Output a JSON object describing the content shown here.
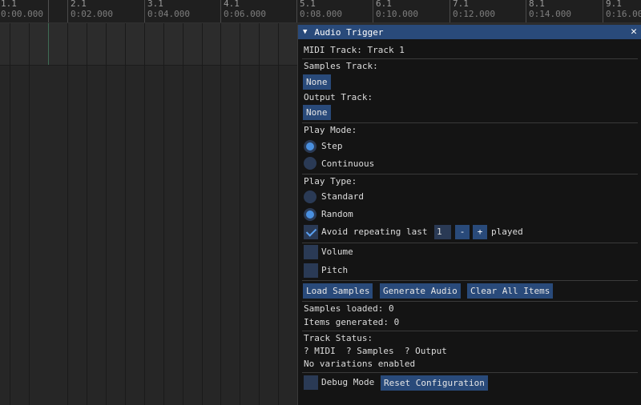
{
  "timeline": {
    "markers": [
      {
        "bar": "1.1",
        "time": "0:00.000"
      },
      {
        "bar": "2.1",
        "time": "0:02.000"
      },
      {
        "bar": "3.1",
        "time": "0:04.000"
      },
      {
        "bar": "4.1",
        "time": "0:06.000"
      },
      {
        "bar": "5.1",
        "time": "0:08.000"
      },
      {
        "bar": "6.1",
        "time": "0:10.000"
      },
      {
        "bar": "7.1",
        "time": "0:12.000"
      },
      {
        "bar": "8.1",
        "time": "0:14.000"
      },
      {
        "bar": "9.1",
        "time": "0:16.000"
      }
    ]
  },
  "panel": {
    "title": "Audio Trigger",
    "collapse_glyph": "▼",
    "close_glyph": "✕",
    "midi_track": "MIDI Track: Track 1",
    "samples_track_label": "Samples Track:",
    "samples_track_value": "None",
    "output_track_label": "Output Track:",
    "output_track_value": "None",
    "play_mode_label": "Play Mode:",
    "play_mode_options": [
      "Step",
      "Continuous"
    ],
    "play_mode_selected": "Step",
    "play_type_label": "Play Type:",
    "play_type_options": [
      "Standard",
      "Random"
    ],
    "play_type_selected": "Random",
    "avoid_repeating_label": "Avoid repeating last",
    "avoid_repeating_checked": true,
    "avoid_repeating_value": "1",
    "minus_label": "-",
    "plus_label": "+",
    "played_label": "played",
    "volume_label": "Volume",
    "volume_checked": false,
    "pitch_label": "Pitch",
    "pitch_checked": false,
    "load_samples_label": "Load Samples",
    "generate_audio_label": "Generate Audio",
    "clear_items_label": "Clear All Items",
    "samples_loaded": "Samples loaded: 0",
    "items_generated": "Items generated: 0",
    "track_status_label": "Track Status:",
    "track_status_line": "? MIDI  ? Samples  ? Output",
    "variations_status": "No variations enabled",
    "debug_mode_label": "Debug Mode",
    "debug_mode_checked": false,
    "reset_config_label": "Reset Configuration"
  },
  "colors": {
    "accent": "#294a7a",
    "radio_active": "#4a90e0",
    "panel_bg": "#141414",
    "timeline_bg": "#262626"
  }
}
